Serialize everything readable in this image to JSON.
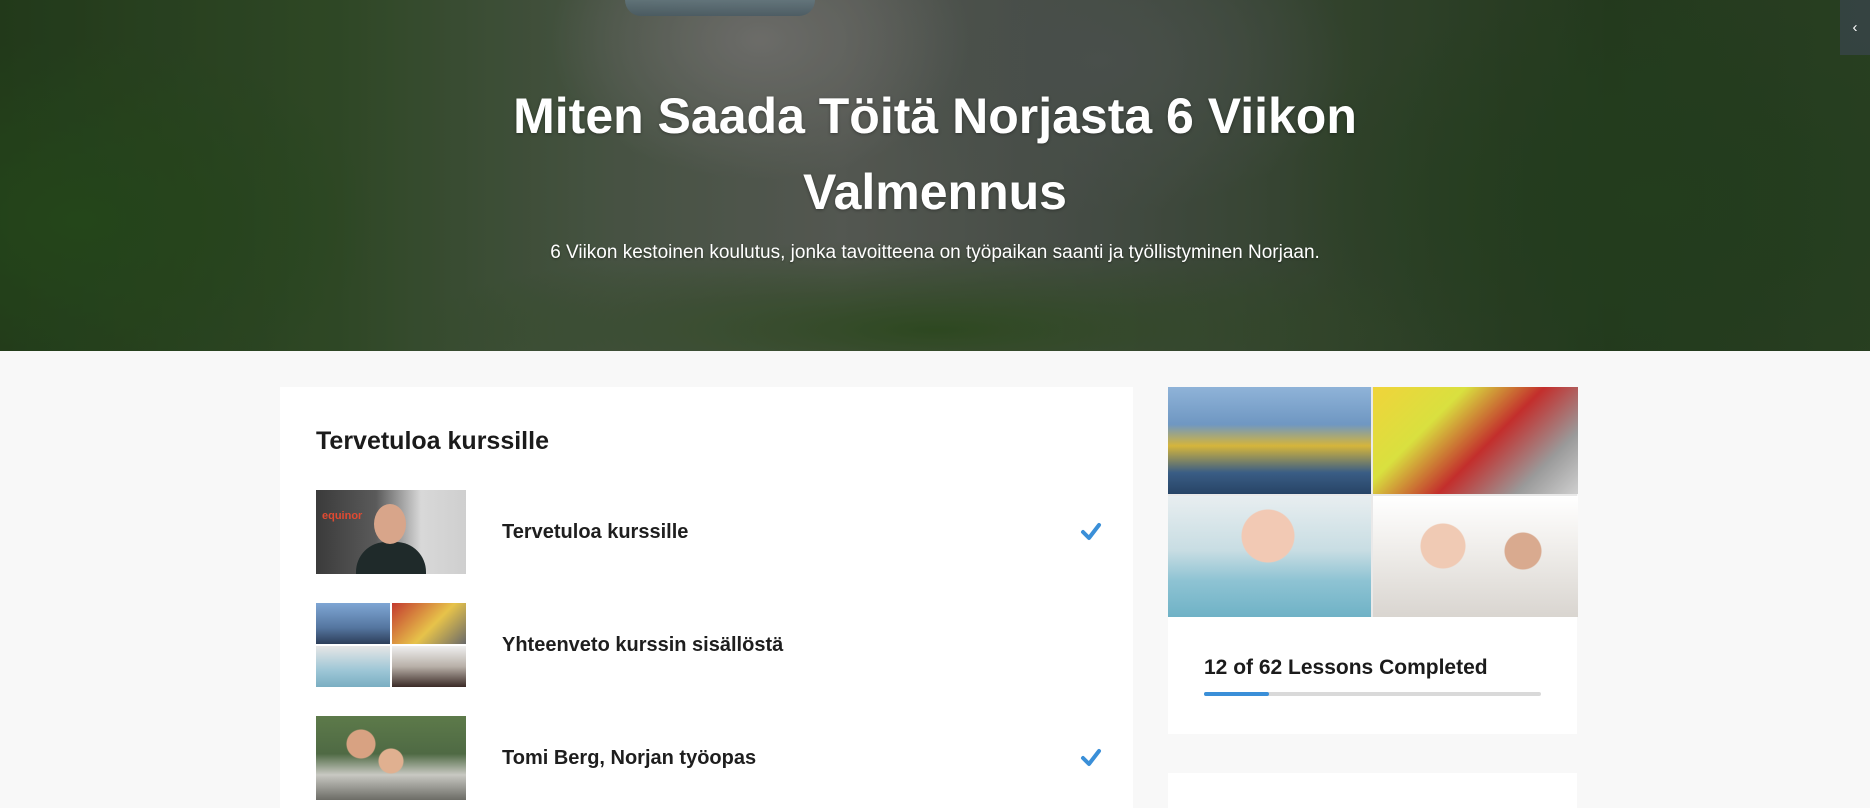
{
  "hero": {
    "title": "Miten Saada Töitä Norjasta 6 Viikon Valmennus",
    "subtitle": "6 Viikon kestoinen koulutus, jonka tavoitteena on työpaikan saanti ja työllistyminen Norjaan."
  },
  "side_toggle": {
    "icon": "chevron-left-icon",
    "glyph": "‹"
  },
  "section": {
    "title": "Tervetuloa kurssille"
  },
  "lessons": [
    {
      "title": "Tervetuloa kurssille",
      "completed": true,
      "thumbnail": "man-portrait-equinor"
    },
    {
      "title": "Yhteenveto kurssin sisällöstä",
      "completed": false,
      "thumbnail": "job-collage"
    },
    {
      "title": "Tomi Berg, Norjan työopas",
      "completed": true,
      "thumbnail": "family-selfie"
    }
  ],
  "thumb_logo_text": "equinor",
  "progress": {
    "text": "12 of 62 Lessons Completed",
    "completed": 12,
    "total": 62
  },
  "colors": {
    "accent": "#3a8fd8",
    "check": "#3a8fd8",
    "page_bg": "#f8f8f8",
    "card_bg": "#ffffff"
  }
}
